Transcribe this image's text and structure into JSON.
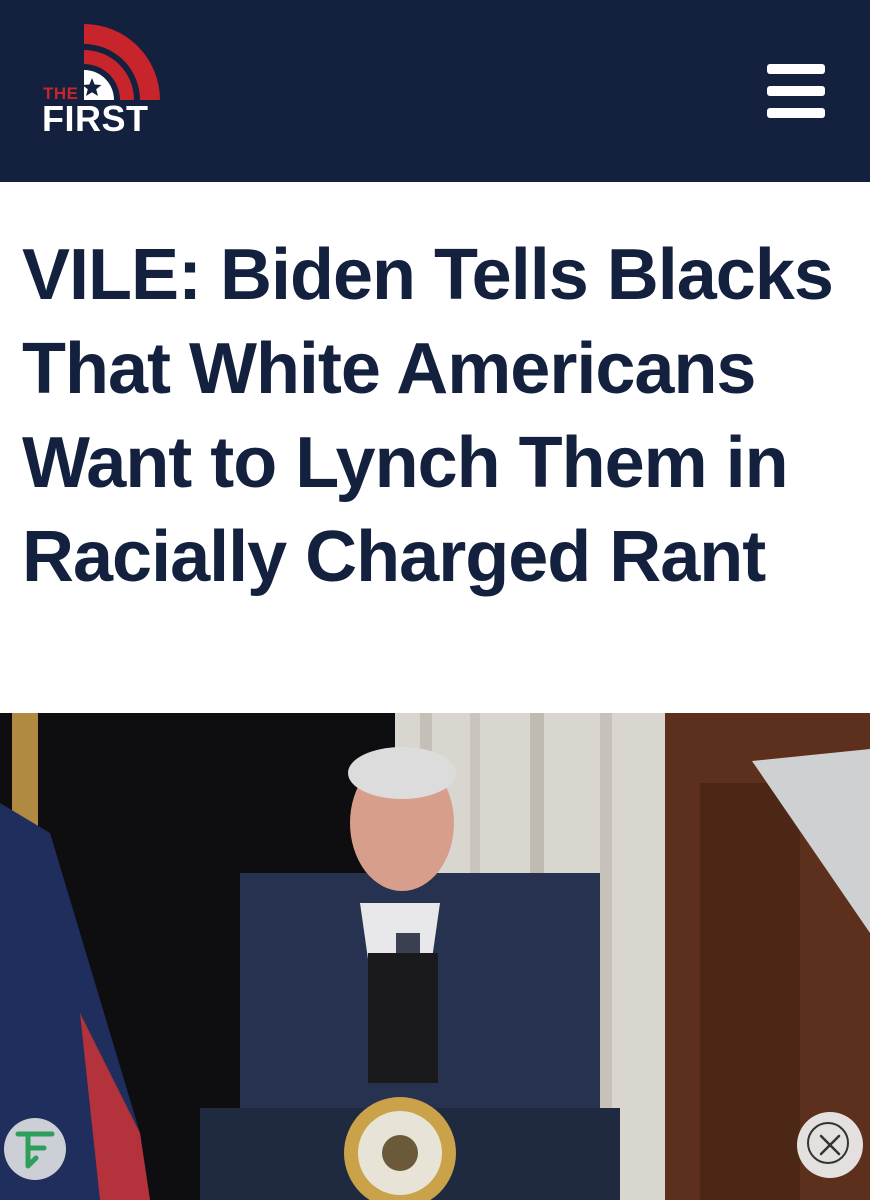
{
  "header": {
    "logo": {
      "the": "THE",
      "first": "FIRST"
    },
    "menu_icon": "hamburger-menu-icon",
    "background": "#13213e",
    "accent": "#c8242b"
  },
  "article": {
    "headline": "VILE: Biden Tells Blacks That White Americans Want to Lynch Them in Racially Charged Rant"
  },
  "overlay": {
    "site_badge_icon": "site-logo-icon",
    "close_icon": "close-icon"
  }
}
